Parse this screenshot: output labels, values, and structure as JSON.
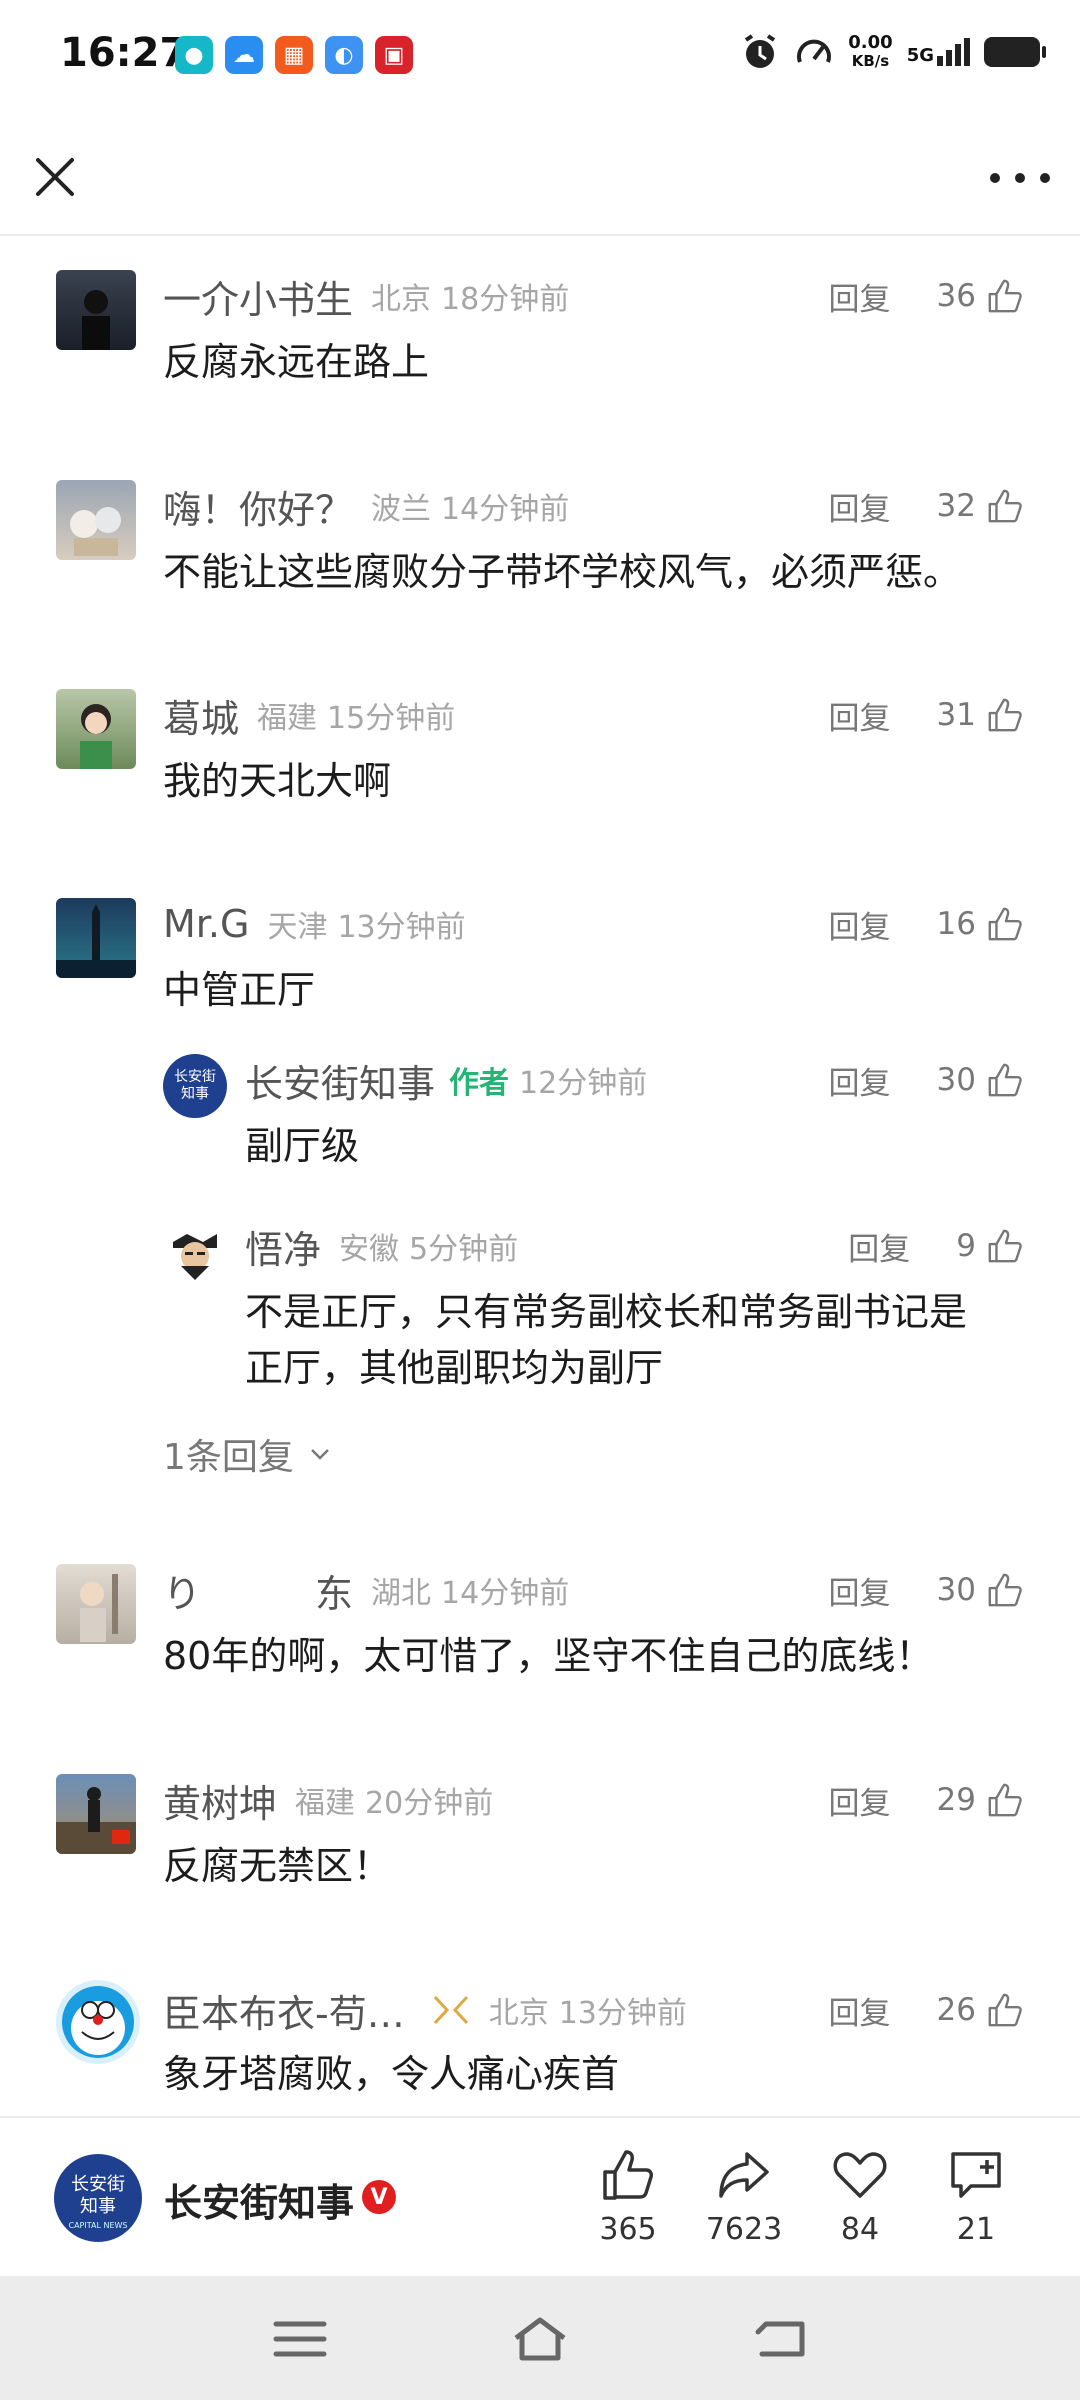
{
  "status_bar": {
    "time": "16:27",
    "network_speed_value": "0.00",
    "network_speed_unit": "KB/s",
    "network_type": "5G",
    "app_icons": [
      "camera-app-icon",
      "cloud-app-icon",
      "grid-app-icon",
      "files-app-icon",
      "calendar-app-icon"
    ]
  },
  "comments": [
    {
      "user": "一介小书生",
      "location": "北京",
      "time": "18分钟前",
      "reply_label": "回复",
      "likes": "36",
      "text": "反腐永远在路上"
    },
    {
      "user": "嗨！你好？",
      "location": "波兰",
      "time": "14分钟前",
      "reply_label": "回复",
      "likes": "32",
      "text": "不能让这些腐败分子带坏学校风气，必须严惩。"
    },
    {
      "user": "葛城",
      "location": "福建",
      "time": "15分钟前",
      "reply_label": "回复",
      "likes": "31",
      "text": "我的天北大啊"
    },
    {
      "user": "Mr.G",
      "location": "天津",
      "time": "13分钟前",
      "reply_label": "回复",
      "likes": "16",
      "text": "中管正厅"
    },
    {
      "user": "り　　　东",
      "location": "湖北",
      "time": "14分钟前",
      "reply_label": "回复",
      "likes": "30",
      "text": "80年的啊，太可惜了，坚守不住自己的底线！"
    },
    {
      "user": "黄树坤",
      "location": "福建",
      "time": "20分钟前",
      "reply_label": "回复",
      "likes": "29",
      "text": "反腐无禁区！"
    },
    {
      "user": "臣本布衣-苟…",
      "location": "北京",
      "time": "13分钟前",
      "reply_label": "回复",
      "likes": "26",
      "text": "象牙塔腐败，令人痛心疾首"
    }
  ],
  "replies": [
    {
      "user": "长安街知事",
      "badge": "作者",
      "time": "12分钟前",
      "reply_label": "回复",
      "likes": "30",
      "text": "副厅级"
    },
    {
      "user": "悟净",
      "location": "安徽",
      "time": "5分钟前",
      "reply_label": "回复",
      "likes": "9",
      "text_line1": "不是正厅，只有常务副校长和常务副书记是",
      "text_line2": "正厅，其他副职均为副厅"
    }
  ],
  "more_replies_label": "1条回复",
  "bottom_bar": {
    "author_name": "长安街知事",
    "verified_mark": "V",
    "author_avatar_text_1": "长安街",
    "author_avatar_text_2": "知事",
    "author_avatar_text_3": "CAPITAL NEWS",
    "like_count": "365",
    "share_count": "7623",
    "favorite_count": "84",
    "comment_count": "21"
  },
  "colors": {
    "author_badge": "#22b573",
    "verified": "#e02020",
    "meta_text": "#a6a6a6",
    "nav_bar_bg": "#ececec"
  }
}
